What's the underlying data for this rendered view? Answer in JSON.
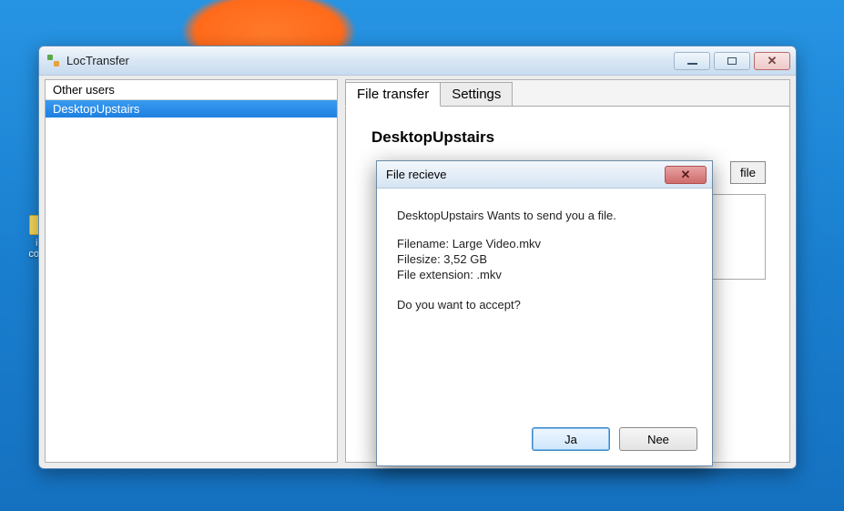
{
  "desktop": {
    "icon_label": "ico\ncopy_"
  },
  "window": {
    "title": "LocTransfer"
  },
  "sidebar": {
    "header": "Other users",
    "items": [
      {
        "label": "DesktopUpstairs",
        "selected": true
      }
    ]
  },
  "main": {
    "tabs": [
      {
        "label": "File transfer",
        "active": true
      },
      {
        "label": "Settings",
        "active": false
      }
    ],
    "content": {
      "heading": "DesktopUpstairs",
      "file_button": "file"
    }
  },
  "dialog": {
    "title": "File recieve",
    "message": "DesktopUpstairs Wants to send you a file.",
    "filename_label": "Filename: ",
    "filename_value": "Large Video.mkv",
    "filesize_label": "Filesize: ",
    "filesize_value": "3,52 GB",
    "ext_label": "File extension: ",
    "ext_value": ".mkv",
    "question": "Do you want to accept?",
    "yes": "Ja",
    "no": "Nee"
  }
}
